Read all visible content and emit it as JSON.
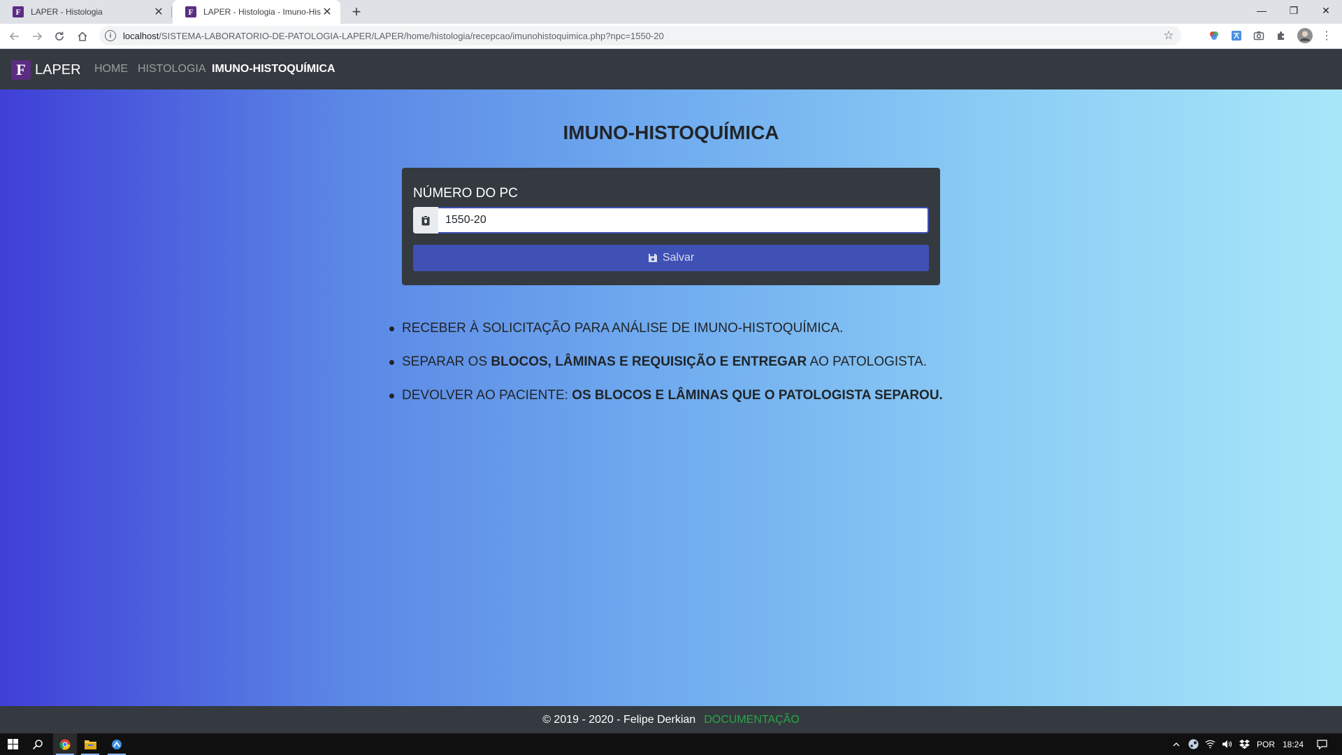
{
  "browser": {
    "tabs": [
      {
        "title": "LAPER - Histologia",
        "active": false
      },
      {
        "title": "LAPER - Histologia - Imuno-Histoquímica",
        "active": true
      }
    ],
    "url_host": "localhost",
    "url_path": "/SISTEMA-LABORATORIO-DE-PATOLOGIA-LAPER/LAPER/home/histologia/recepcao/imunohistoquimica.php?npc=1550-20",
    "favicon_letter": "F"
  },
  "navbar": {
    "brand_letter": "F",
    "brand": "LAPER",
    "links": [
      {
        "label": "HOME",
        "active": false
      },
      {
        "label": "HISTOLOGIA",
        "active": false
      },
      {
        "label": "IMUNO-HISTOQUÍMICA",
        "active": true
      }
    ]
  },
  "main": {
    "title": "IMUNO-HISTOQUÍMICA",
    "form": {
      "label": "NÚMERO DO PC",
      "value": "1550-20",
      "save_label": "Salvar"
    },
    "instructions": [
      {
        "parts": [
          {
            "text": "RECEBER À SOLICITAÇÃO PARA ANÁLISE DE IMUNO-HISTOQUÍMICA.",
            "bold": false
          }
        ]
      },
      {
        "parts": [
          {
            "text": "SEPARAR OS ",
            "bold": false
          },
          {
            "text": "BLOCOS, LÂMINAS E REQUISIÇÃO E ENTREGAR",
            "bold": true
          },
          {
            "text": " AO PATOLOGISTA.",
            "bold": false
          }
        ]
      },
      {
        "parts": [
          {
            "text": "DEVOLVER AO PACIENTE: ",
            "bold": false
          },
          {
            "text": "OS BLOCOS E LÂMINAS QUE O PATOLOGISTA SEPAROU.",
            "bold": true
          }
        ]
      }
    ]
  },
  "footer": {
    "copyright": "© 2019 - 2020 - Felipe Derkian",
    "link": "DOCUMENTAÇÃO"
  },
  "taskbar": {
    "language": "POR",
    "time": "18:24"
  },
  "colors": {
    "navbar_bg": "#343a40",
    "primary": "#3f51b5",
    "link_green": "#28a745",
    "brand_purple": "#5b2d82"
  }
}
